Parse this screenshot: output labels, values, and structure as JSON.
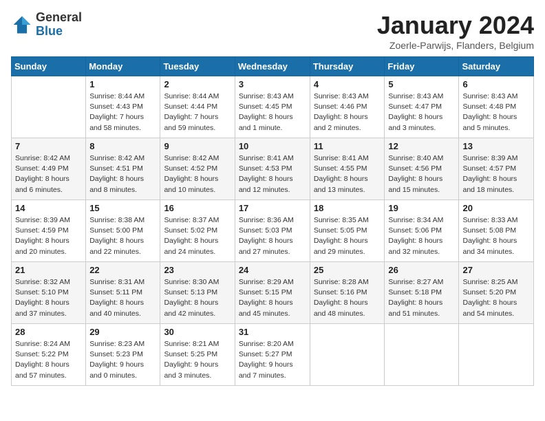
{
  "logo": {
    "general": "General",
    "blue": "Blue"
  },
  "title": "January 2024",
  "location": "Zoerle-Parwijs, Flanders, Belgium",
  "weekdays": [
    "Sunday",
    "Monday",
    "Tuesday",
    "Wednesday",
    "Thursday",
    "Friday",
    "Saturday"
  ],
  "weeks": [
    [
      {
        "day": "",
        "info": ""
      },
      {
        "day": "1",
        "info": "Sunrise: 8:44 AM\nSunset: 4:43 PM\nDaylight: 7 hours\nand 58 minutes."
      },
      {
        "day": "2",
        "info": "Sunrise: 8:44 AM\nSunset: 4:44 PM\nDaylight: 7 hours\nand 59 minutes."
      },
      {
        "day": "3",
        "info": "Sunrise: 8:43 AM\nSunset: 4:45 PM\nDaylight: 8 hours\nand 1 minute."
      },
      {
        "day": "4",
        "info": "Sunrise: 8:43 AM\nSunset: 4:46 PM\nDaylight: 8 hours\nand 2 minutes."
      },
      {
        "day": "5",
        "info": "Sunrise: 8:43 AM\nSunset: 4:47 PM\nDaylight: 8 hours\nand 3 minutes."
      },
      {
        "day": "6",
        "info": "Sunrise: 8:43 AM\nSunset: 4:48 PM\nDaylight: 8 hours\nand 5 minutes."
      }
    ],
    [
      {
        "day": "7",
        "info": "Sunrise: 8:42 AM\nSunset: 4:49 PM\nDaylight: 8 hours\nand 6 minutes."
      },
      {
        "day": "8",
        "info": "Sunrise: 8:42 AM\nSunset: 4:51 PM\nDaylight: 8 hours\nand 8 minutes."
      },
      {
        "day": "9",
        "info": "Sunrise: 8:42 AM\nSunset: 4:52 PM\nDaylight: 8 hours\nand 10 minutes."
      },
      {
        "day": "10",
        "info": "Sunrise: 8:41 AM\nSunset: 4:53 PM\nDaylight: 8 hours\nand 12 minutes."
      },
      {
        "day": "11",
        "info": "Sunrise: 8:41 AM\nSunset: 4:55 PM\nDaylight: 8 hours\nand 13 minutes."
      },
      {
        "day": "12",
        "info": "Sunrise: 8:40 AM\nSunset: 4:56 PM\nDaylight: 8 hours\nand 15 minutes."
      },
      {
        "day": "13",
        "info": "Sunrise: 8:39 AM\nSunset: 4:57 PM\nDaylight: 8 hours\nand 18 minutes."
      }
    ],
    [
      {
        "day": "14",
        "info": "Sunrise: 8:39 AM\nSunset: 4:59 PM\nDaylight: 8 hours\nand 20 minutes."
      },
      {
        "day": "15",
        "info": "Sunrise: 8:38 AM\nSunset: 5:00 PM\nDaylight: 8 hours\nand 22 minutes."
      },
      {
        "day": "16",
        "info": "Sunrise: 8:37 AM\nSunset: 5:02 PM\nDaylight: 8 hours\nand 24 minutes."
      },
      {
        "day": "17",
        "info": "Sunrise: 8:36 AM\nSunset: 5:03 PM\nDaylight: 8 hours\nand 27 minutes."
      },
      {
        "day": "18",
        "info": "Sunrise: 8:35 AM\nSunset: 5:05 PM\nDaylight: 8 hours\nand 29 minutes."
      },
      {
        "day": "19",
        "info": "Sunrise: 8:34 AM\nSunset: 5:06 PM\nDaylight: 8 hours\nand 32 minutes."
      },
      {
        "day": "20",
        "info": "Sunrise: 8:33 AM\nSunset: 5:08 PM\nDaylight: 8 hours\nand 34 minutes."
      }
    ],
    [
      {
        "day": "21",
        "info": "Sunrise: 8:32 AM\nSunset: 5:10 PM\nDaylight: 8 hours\nand 37 minutes."
      },
      {
        "day": "22",
        "info": "Sunrise: 8:31 AM\nSunset: 5:11 PM\nDaylight: 8 hours\nand 40 minutes."
      },
      {
        "day": "23",
        "info": "Sunrise: 8:30 AM\nSunset: 5:13 PM\nDaylight: 8 hours\nand 42 minutes."
      },
      {
        "day": "24",
        "info": "Sunrise: 8:29 AM\nSunset: 5:15 PM\nDaylight: 8 hours\nand 45 minutes."
      },
      {
        "day": "25",
        "info": "Sunrise: 8:28 AM\nSunset: 5:16 PM\nDaylight: 8 hours\nand 48 minutes."
      },
      {
        "day": "26",
        "info": "Sunrise: 8:27 AM\nSunset: 5:18 PM\nDaylight: 8 hours\nand 51 minutes."
      },
      {
        "day": "27",
        "info": "Sunrise: 8:25 AM\nSunset: 5:20 PM\nDaylight: 8 hours\nand 54 minutes."
      }
    ],
    [
      {
        "day": "28",
        "info": "Sunrise: 8:24 AM\nSunset: 5:22 PM\nDaylight: 8 hours\nand 57 minutes."
      },
      {
        "day": "29",
        "info": "Sunrise: 8:23 AM\nSunset: 5:23 PM\nDaylight: 9 hours\nand 0 minutes."
      },
      {
        "day": "30",
        "info": "Sunrise: 8:21 AM\nSunset: 5:25 PM\nDaylight: 9 hours\nand 3 minutes."
      },
      {
        "day": "31",
        "info": "Sunrise: 8:20 AM\nSunset: 5:27 PM\nDaylight: 9 hours\nand 7 minutes."
      },
      {
        "day": "",
        "info": ""
      },
      {
        "day": "",
        "info": ""
      },
      {
        "day": "",
        "info": ""
      }
    ]
  ]
}
